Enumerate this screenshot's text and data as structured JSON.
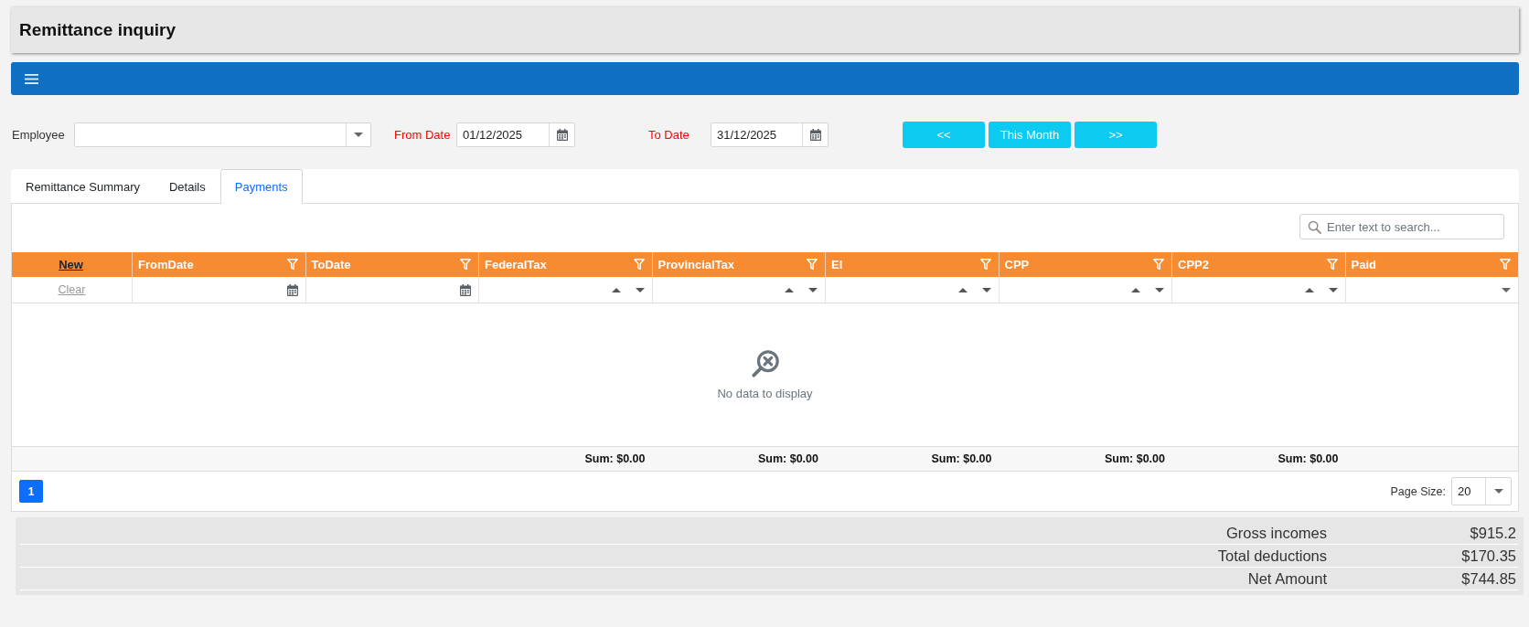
{
  "header": {
    "title": "Remittance inquiry"
  },
  "filters": {
    "employee": {
      "label": "Employee",
      "required": false
    },
    "from_date": {
      "label": "From Date",
      "required": true,
      "value": "01/12/2025"
    },
    "to_date": {
      "label": "To Date",
      "required": true,
      "value": "31/12/2025"
    }
  },
  "period_buttons": [
    "<<",
    "This Month",
    ">>"
  ],
  "tabs": [
    {
      "label": "Remittance Summary",
      "selected": false
    },
    {
      "label": "Details",
      "selected": false
    },
    {
      "label": "Payments",
      "selected": true
    }
  ],
  "grid": {
    "search": {
      "placeholder": "Enter text to search..."
    },
    "command_column": {
      "new_label": "New",
      "clear_label": "Clear"
    },
    "columns": [
      {
        "label": "FromDate",
        "kind": "date"
      },
      {
        "label": "ToDate",
        "kind": "date"
      },
      {
        "label": "FederalTax",
        "kind": "number",
        "total": "Sum: $0.00"
      },
      {
        "label": "ProvincialTax",
        "kind": "number",
        "total": "Sum: $0.00"
      },
      {
        "label": "EI",
        "kind": "number",
        "total": "Sum: $0.00"
      },
      {
        "label": "CPP",
        "kind": "number",
        "total": "Sum: $0.00"
      },
      {
        "label": "CPP2",
        "kind": "number",
        "total": "Sum: $0.00"
      },
      {
        "label": "Paid",
        "kind": "boolean"
      }
    ],
    "empty_text": "No data to display"
  },
  "pager": {
    "pages": [
      {
        "label": "1",
        "selected": true
      }
    ],
    "page_size_label": "Page Size:",
    "page_size": "20"
  },
  "summary": [
    {
      "label": "Gross incomes",
      "value": "$915.2"
    },
    {
      "label": "Total deductions",
      "value": "$170.35"
    },
    {
      "label": "Net Amount",
      "value": "$744.85"
    }
  ]
}
